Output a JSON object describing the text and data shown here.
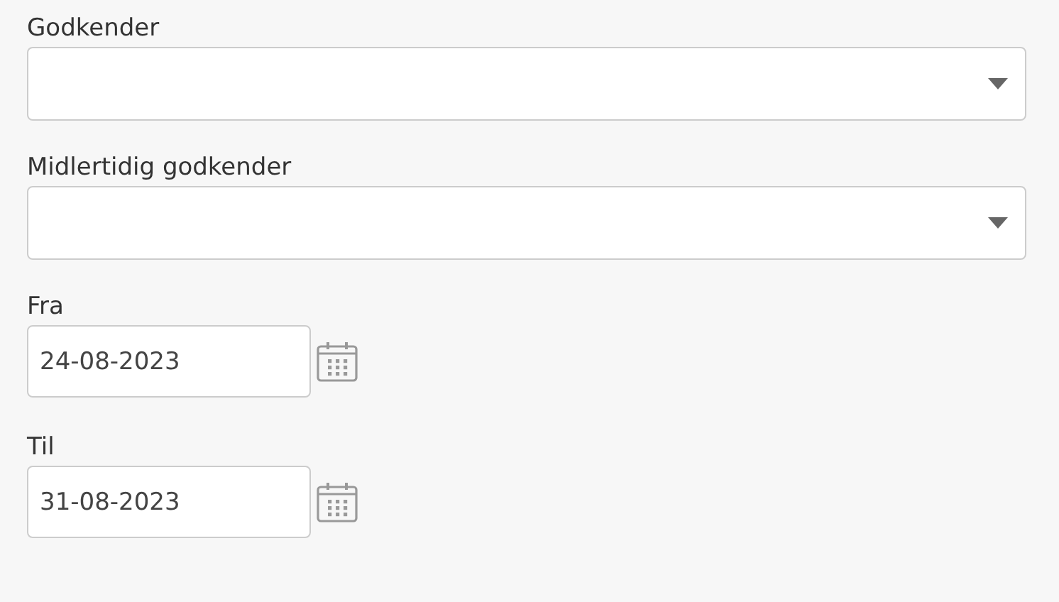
{
  "fields": [
    {
      "kind": "select",
      "label": "Godkender"
    },
    {
      "kind": "select",
      "label": "Midlertidig godkender"
    },
    {
      "kind": "date",
      "label": "Fra",
      "value": "24-08-2023"
    },
    {
      "kind": "date",
      "label": "Til",
      "value": "31-08-2023"
    }
  ]
}
